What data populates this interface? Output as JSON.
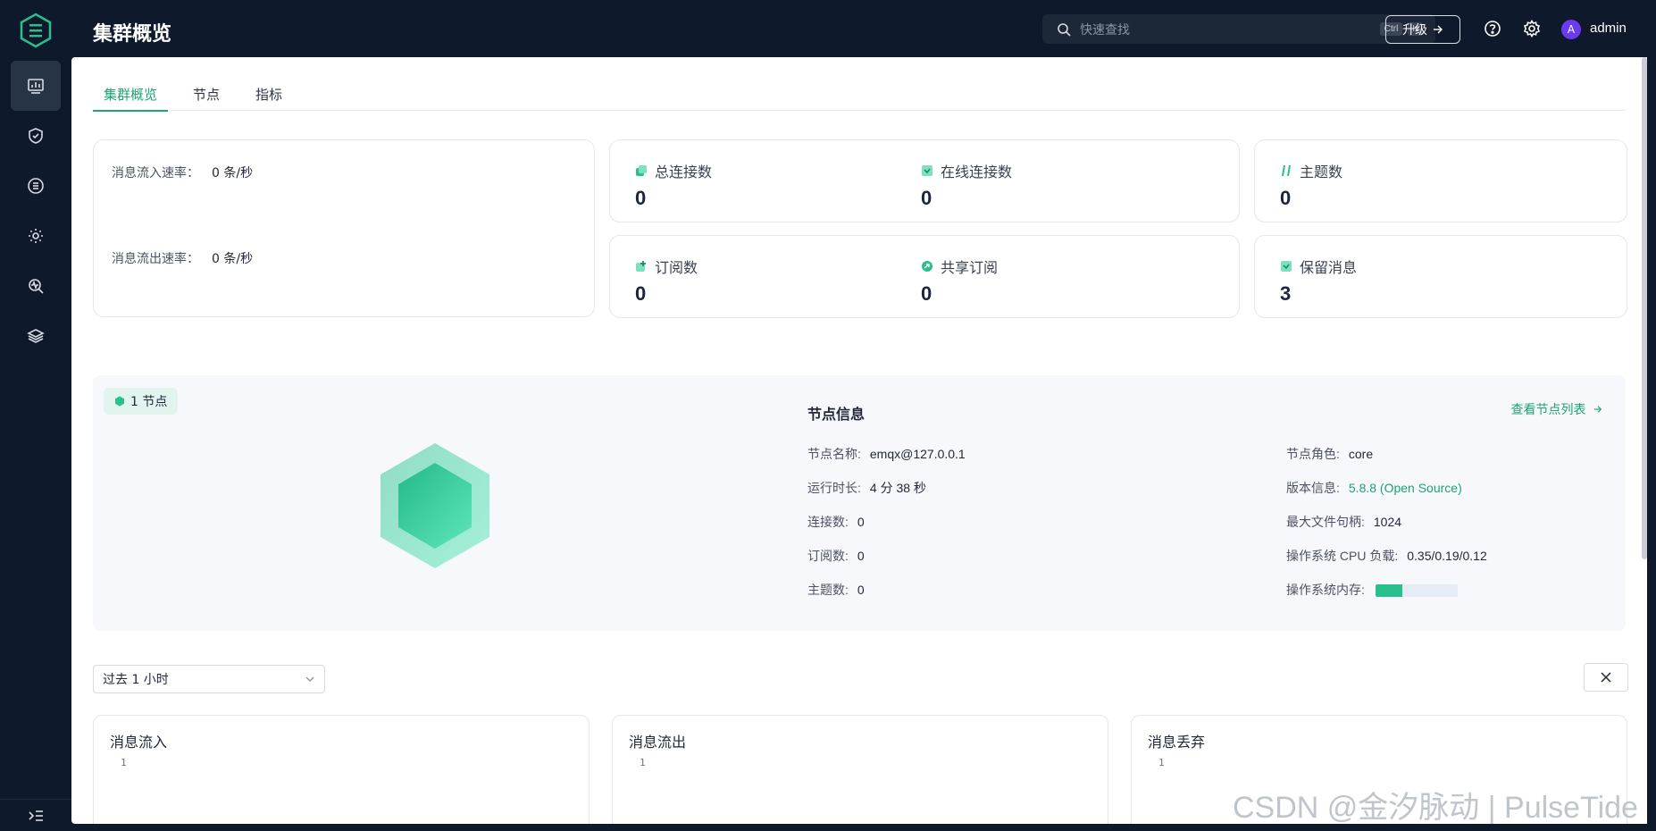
{
  "header": {
    "title": "集群概览",
    "search_placeholder": "快速查找",
    "kbd_ctrl": "Ctrl",
    "kbd_k": "K",
    "upgrade_label": "升级",
    "avatar_letter": "A",
    "username": "admin"
  },
  "sidebar": {
    "items": [
      "dashboard-icon",
      "shield-icon",
      "list-icon",
      "gear-cog-icon",
      "diagnose-icon",
      "layers-icon"
    ],
    "active_index": 0
  },
  "tabs": [
    {
      "label": "集群概览",
      "active": true
    },
    {
      "label": "节点",
      "active": false
    },
    {
      "label": "指标",
      "active": false
    }
  ],
  "rates": {
    "in_label": "消息流入速率：",
    "in_value": "0 条/秒",
    "out_label": "消息流出速率：",
    "out_value": "0 条/秒"
  },
  "stats": {
    "total_connections": {
      "label": "总连接数",
      "value": "0"
    },
    "online_connections": {
      "label": "在线连接数",
      "value": "0"
    },
    "topics": {
      "label": "主题数",
      "value": "0"
    },
    "subscriptions": {
      "label": "订阅数",
      "value": "0"
    },
    "shared_subscriptions": {
      "label": "共享订阅",
      "value": "0"
    },
    "retained": {
      "label": "保留消息",
      "value": "3"
    }
  },
  "node": {
    "badge": "1 节点",
    "title": "节点信息",
    "link": "查看节点列表",
    "name_label": "节点名称:",
    "name_value": "emqx@127.0.0.1",
    "uptime_label": "运行时长:",
    "uptime_value": "4 分 38 秒",
    "conn_label": "连接数:",
    "conn_value": "0",
    "sub_label": "订阅数:",
    "sub_value": "0",
    "topic_label": "主题数:",
    "topic_value": "0",
    "role_label": "节点角色:",
    "role_value": "core",
    "version_label": "版本信息:",
    "version_value": "5.8.8 (Open Source)",
    "fd_label": "最大文件句柄:",
    "fd_value": "1024",
    "cpu_label": "操作系统 CPU 负载:",
    "cpu_value": "0.35/0.19/0.12",
    "mem_label": "操作系统内存:",
    "mem_fraction": 0.33
  },
  "time_range": "过去 1 小时",
  "charts": [
    {
      "title": "消息流入",
      "tick": "1"
    },
    {
      "title": "消息流出",
      "tick": "1"
    },
    {
      "title": "消息丢弃",
      "tick": "1"
    }
  ],
  "watermark": "CSDN @金汐脉动 | PulseTide",
  "colors": {
    "accent": "#1ea373",
    "sidebar": "#0e1a2b"
  }
}
